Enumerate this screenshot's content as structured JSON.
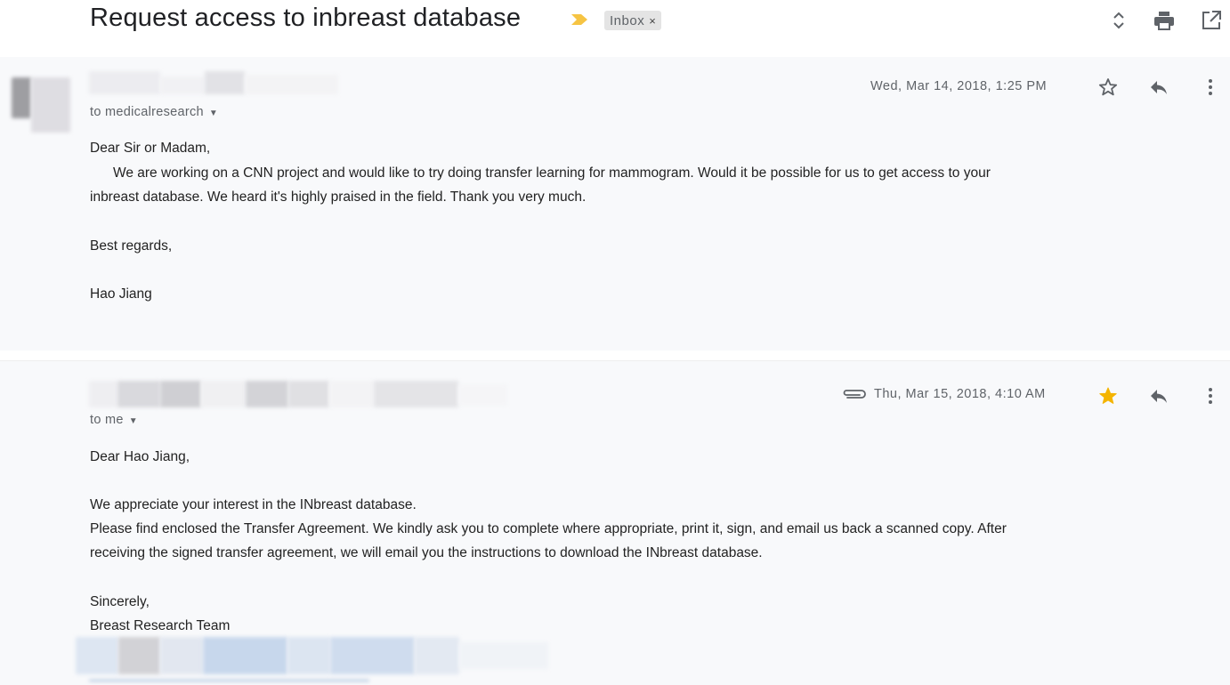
{
  "thread": {
    "subject": "Request access to inbreast database",
    "label": "Inbox",
    "label_remove": "×"
  },
  "header_icons": {
    "expand": "unfold-icon",
    "print": "print-icon",
    "open_new_window": "open-in-new-icon"
  },
  "messages": [
    {
      "recipient_line": "to medicalresearch",
      "date": "Wed, Mar 14, 2018, 1:25 PM",
      "starred": false,
      "greeting": "Dear Sir or Madam,",
      "body_lines": [
        "We are working on a CNN project and would like to try doing transfer learning for mammogram. Would it be possible for us to get access to your",
        "inbreast database. We heard it's highly praised in the field. Thank you very much."
      ],
      "closing": "Best regards,",
      "signature": "Hao Jiang"
    },
    {
      "recipient_line": "to me",
      "has_attachment": true,
      "date": "Thu, Mar 15, 2018, 4:10 AM",
      "starred": true,
      "greeting": "Dear Hao Jiang,",
      "body_lines": [
        "We appreciate your interest in the INbreast database.",
        "Please find enclosed the Transfer Agreement. We kindly ask you to complete where appropriate, print it, sign, and email us back a scanned copy. After",
        "receiving the signed transfer agreement, we will email you the instructions to download the INbreast database."
      ],
      "closing": "Sincerely,",
      "signature": "Breast Research Team"
    }
  ],
  "colors": {
    "star_filled": "#f4b400",
    "label_bg": "#e4e4e4",
    "importance_marker": "#f6c443",
    "message_bg": "#f8f9fb"
  }
}
